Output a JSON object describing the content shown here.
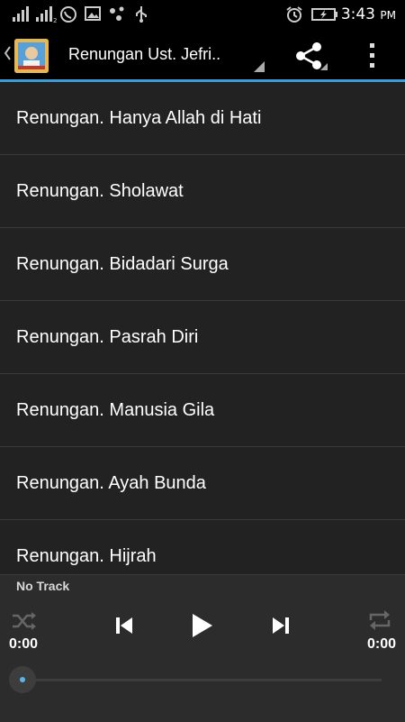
{
  "status_bar": {
    "time": "3:43",
    "ampm": "PM",
    "icons": [
      "signal-icon",
      "signal-2-icon",
      "whatsapp-icon",
      "image-icon",
      "dots-icon",
      "usb-icon",
      "alarm-icon",
      "battery-icon"
    ]
  },
  "action_bar": {
    "title": "Renungan Ust. Jefri..",
    "accent_color": "#3a9bd5"
  },
  "list": {
    "items": [
      {
        "label": "Renungan. Hanya Allah di Hati"
      },
      {
        "label": "Renungan. Sholawat"
      },
      {
        "label": "Renungan. Bidadari Surga"
      },
      {
        "label": "Renungan. Pasrah Diri"
      },
      {
        "label": "Renungan. Manusia Gila"
      },
      {
        "label": "Renungan. Ayah Bunda"
      },
      {
        "label": "Renungan. Hijrah"
      }
    ]
  },
  "player": {
    "track_name": "No Track",
    "elapsed": "0:00",
    "duration": "0:00",
    "progress": 0
  }
}
